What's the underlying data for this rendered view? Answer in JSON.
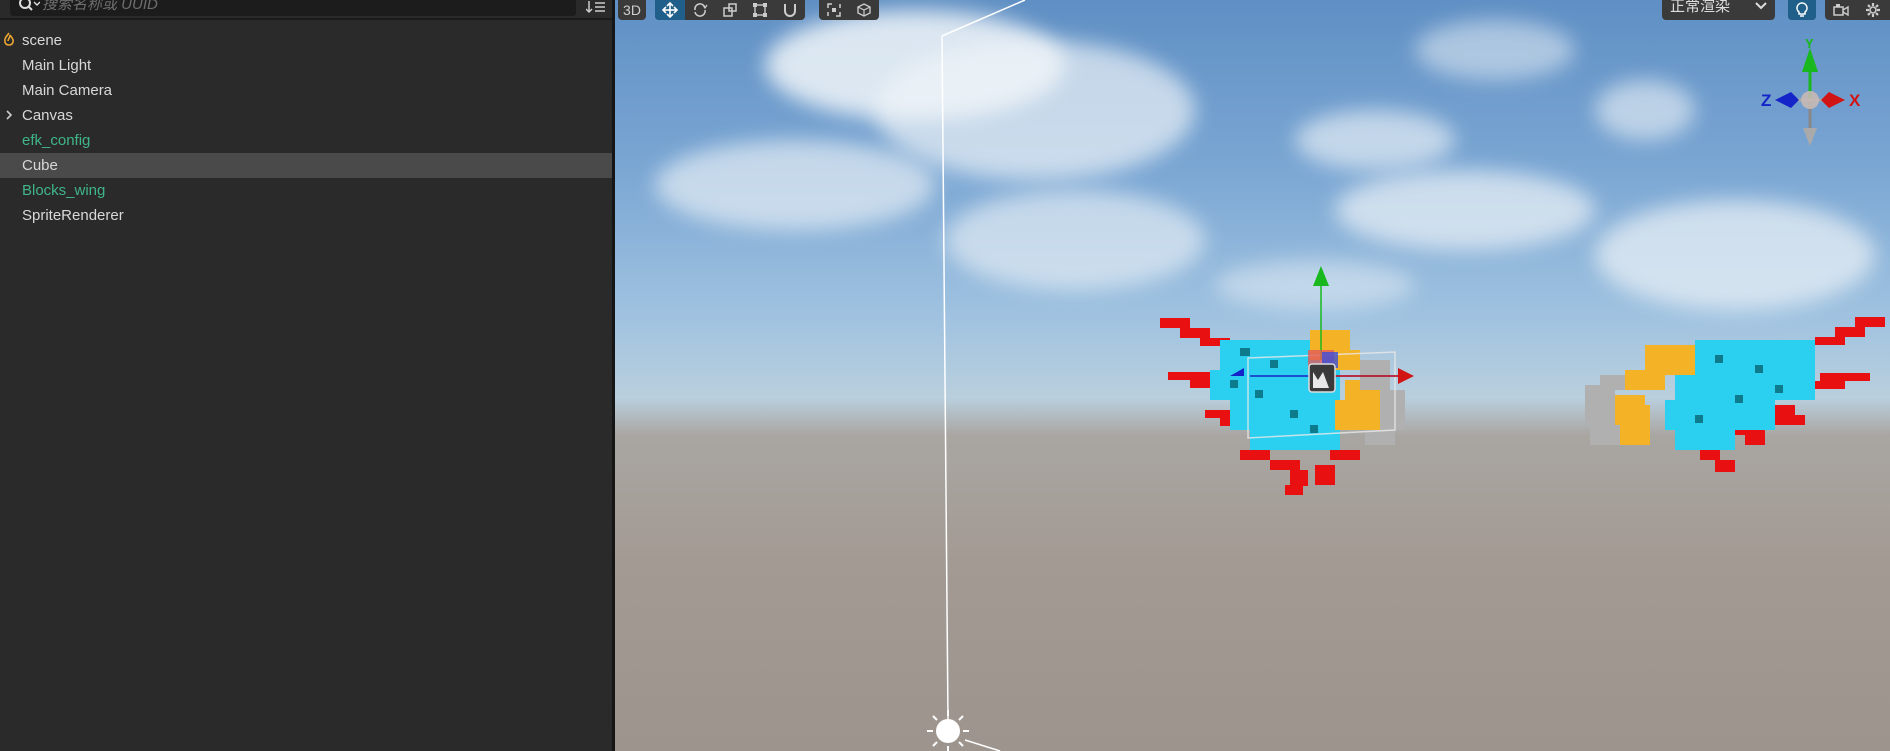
{
  "hierarchy": {
    "search": {
      "placeholder": "搜索名称或 UUID"
    },
    "items": [
      {
        "label": "scene",
        "type": "scene",
        "selected": false
      },
      {
        "label": "Main Light",
        "type": "node",
        "selected": false
      },
      {
        "label": "Main Camera",
        "type": "node",
        "selected": false
      },
      {
        "label": "Canvas",
        "type": "node",
        "expandable": true,
        "selected": false
      },
      {
        "label": "efk_config",
        "type": "prefab",
        "selected": false
      },
      {
        "label": "Cube",
        "type": "node",
        "selected": true
      },
      {
        "label": "Blocks_wing",
        "type": "prefab",
        "selected": false
      },
      {
        "label": "SpriteRenderer",
        "type": "node",
        "selected": false
      }
    ]
  },
  "viewport": {
    "toolbar": {
      "mode_label": "3D",
      "render_mode": "正常渲染",
      "tools": [
        "move-tool",
        "rotate-tool",
        "scale-tool",
        "rect-tool",
        "snap-tool"
      ],
      "pivot_tools": [
        "pivot-tool",
        "world-space-tool"
      ],
      "right_icons": [
        "light-bulb-icon",
        "camera-icon",
        "gear-icon"
      ]
    },
    "gizmo_axes": {
      "x": "X",
      "z": "Z",
      "y": "Y"
    },
    "colors": {
      "x_axis": "#d11515",
      "y_axis": "#18b81e",
      "z_axis": "#1424c8",
      "selection_blue": "#1f5f8a",
      "prefab_text": "#3fb58a"
    }
  }
}
